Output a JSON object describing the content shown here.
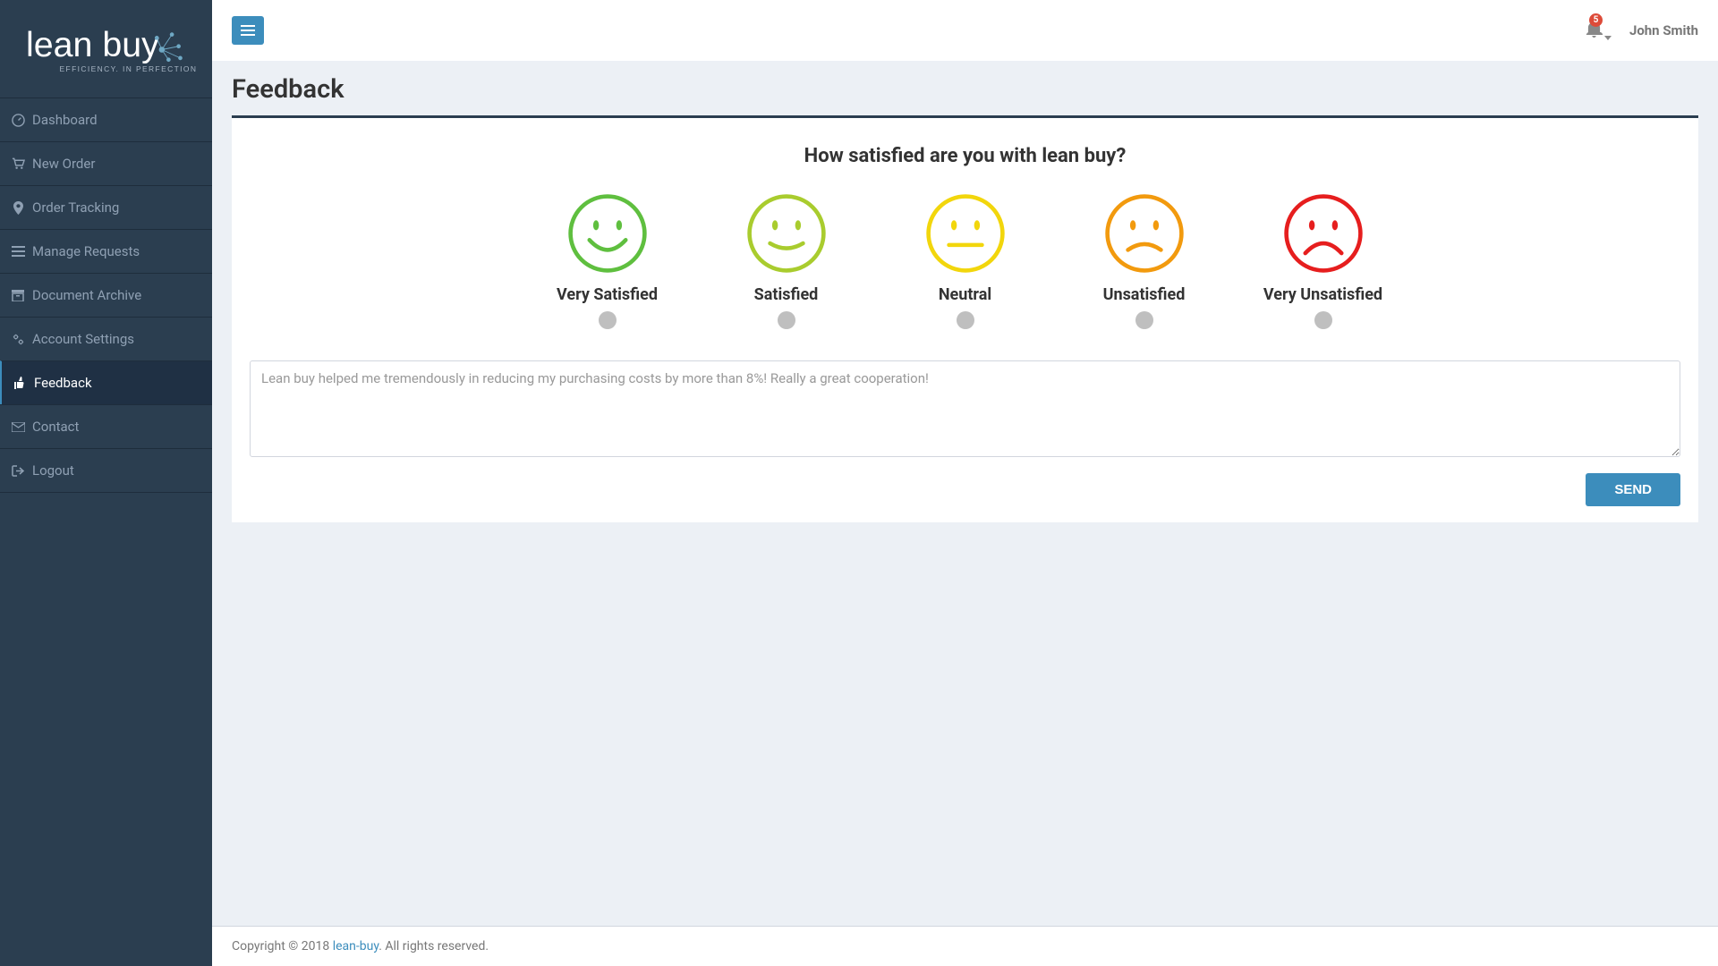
{
  "brand": {
    "name": "lean buy",
    "tagline": "EFFICIENCY. IN PERFECTION"
  },
  "sidebar": {
    "items": [
      {
        "label": "Dashboard",
        "icon": "dashboard"
      },
      {
        "label": "New Order",
        "icon": "cart"
      },
      {
        "label": "Order Tracking",
        "icon": "pin"
      },
      {
        "label": "Manage Requests",
        "icon": "list"
      },
      {
        "label": "Document Archive",
        "icon": "archive"
      },
      {
        "label": "Account Settings",
        "icon": "cogs"
      },
      {
        "label": "Feedback",
        "icon": "thumb"
      },
      {
        "label": "Contact",
        "icon": "envelope"
      },
      {
        "label": "Logout",
        "icon": "signout"
      }
    ],
    "active_index": 6
  },
  "header": {
    "notification_count": "5",
    "username": "John Smith"
  },
  "page": {
    "title": "Feedback"
  },
  "feedback": {
    "question": "How satisfied are you with lean buy?",
    "options": [
      {
        "label": "Very Satisfied",
        "color": "#5fbf3f"
      },
      {
        "label": "Satisfied",
        "color": "#a9cc2e"
      },
      {
        "label": "Neutral",
        "color": "#f2d60c"
      },
      {
        "label": "Unsatisfied",
        "color": "#f29a0e"
      },
      {
        "label": "Very Unsatisfied",
        "color": "#e61e1e"
      }
    ],
    "textarea_placeholder": "Lean buy helped me tremendously in reducing my purchasing costs by more than 8%! Really a great cooperation!",
    "send_label": "SEND"
  },
  "footer": {
    "prefix": "Copyright © 2018 ",
    "link_text": "lean-buy",
    "suffix": ". All rights reserved."
  }
}
